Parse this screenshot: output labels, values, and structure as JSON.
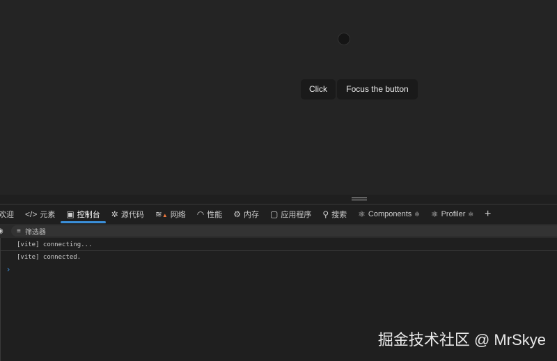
{
  "page": {
    "click_label": "Click",
    "focus_label": "Focus the button"
  },
  "devtools": {
    "tabs": [
      {
        "label": "欢迎",
        "icon": "welcome-icon"
      },
      {
        "label": "元素",
        "icon": "code-icon"
      },
      {
        "label": "控制台",
        "icon": "console-icon",
        "active": true
      },
      {
        "label": "源代码",
        "icon": "bug-icon"
      },
      {
        "label": "网络",
        "icon": "wifi-warning-icon"
      },
      {
        "label": "性能",
        "icon": "gauge-icon"
      },
      {
        "label": "内存",
        "icon": "chip-icon"
      },
      {
        "label": "应用程序",
        "icon": "app-icon"
      },
      {
        "label": "搜索",
        "icon": "search-icon"
      },
      {
        "label": "Components",
        "icon": "react-icon"
      },
      {
        "label": "Profiler",
        "icon": "react-icon"
      }
    ],
    "filter_placeholder": "筛选器",
    "logs": [
      "[vite] connecting...",
      "[vite] connected."
    ],
    "prompt": "›"
  },
  "watermark": "掘金技术社区 @ MrSkye",
  "colors": {
    "accent": "#3b8fd9",
    "react": "#61dafb",
    "warning": "#f0783c"
  }
}
